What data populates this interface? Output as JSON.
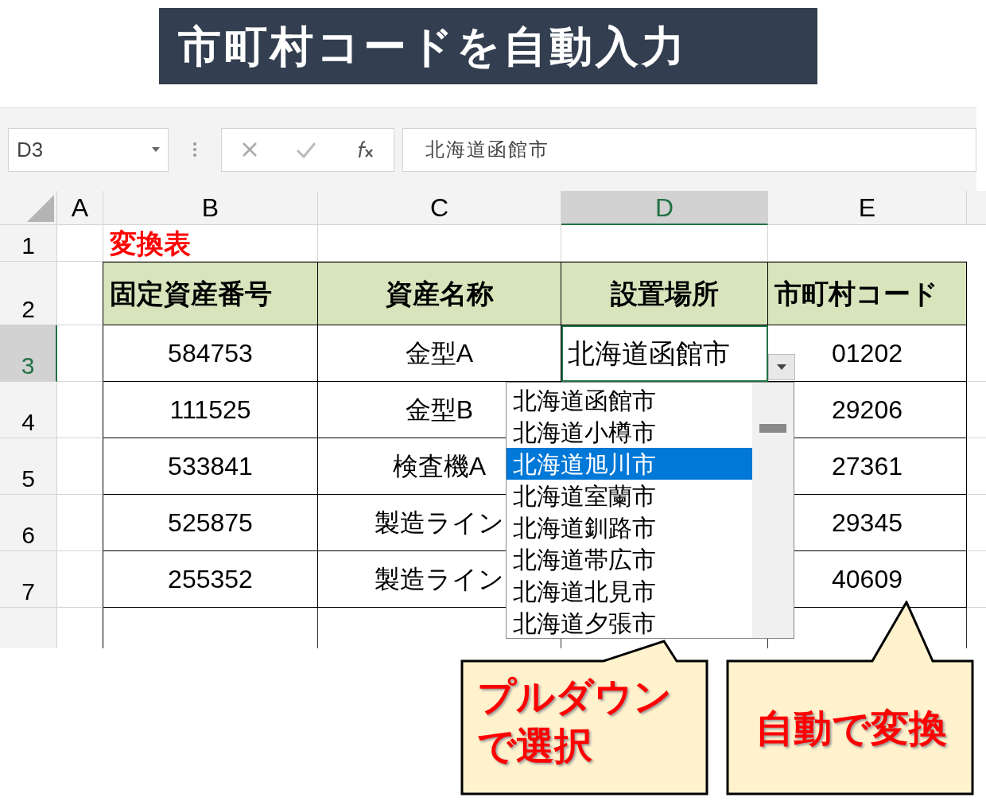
{
  "banner": {
    "title": "市町村コードを自動入力"
  },
  "name_box": {
    "value": "D3"
  },
  "formula_bar": {
    "value": "北海道函館市"
  },
  "columns": [
    {
      "label": "A",
      "selected": false
    },
    {
      "label": "B",
      "selected": false
    },
    {
      "label": "C",
      "selected": false
    },
    {
      "label": "D",
      "selected": true
    },
    {
      "label": "E",
      "selected": false
    }
  ],
  "title_row": {
    "label": "1",
    "selected": false,
    "title": "変換表"
  },
  "header_row": {
    "label": "2",
    "selected": false,
    "headers": [
      "固定資産番号",
      "資産名称",
      "設置場所",
      "市町村コード"
    ]
  },
  "data_rows": [
    {
      "label": "3",
      "selected": true,
      "asset_no": "584753",
      "asset_name": "金型A",
      "location": "北海道函館市",
      "code": "01202"
    },
    {
      "label": "4",
      "selected": false,
      "asset_no": "111525",
      "asset_name": "金型B",
      "code": "29206"
    },
    {
      "label": "5",
      "selected": false,
      "asset_no": "533841",
      "asset_name": "検査機A",
      "code": "27361"
    },
    {
      "label": "6",
      "selected": false,
      "asset_no": "525875",
      "asset_name": "製造ライン",
      "code": "29345"
    },
    {
      "label": "7",
      "selected": false,
      "asset_no": "255352",
      "asset_name": "製造ライン",
      "code": "40609"
    }
  ],
  "dropdown": {
    "options": [
      {
        "label": "北海道函館市",
        "selected": false
      },
      {
        "label": "北海道小樽市",
        "selected": false
      },
      {
        "label": "北海道旭川市",
        "selected": true
      },
      {
        "label": "北海道室蘭市",
        "selected": false
      },
      {
        "label": "北海道釧路市",
        "selected": false
      },
      {
        "label": "北海道帯広市",
        "selected": false
      },
      {
        "label": "北海道北見市",
        "selected": false
      },
      {
        "label": "北海道夕張市",
        "selected": false
      }
    ]
  },
  "callouts": [
    {
      "lines": [
        "プルダウン",
        "で選択"
      ]
    },
    {
      "lines": [
        "自動で変換"
      ]
    }
  ]
}
